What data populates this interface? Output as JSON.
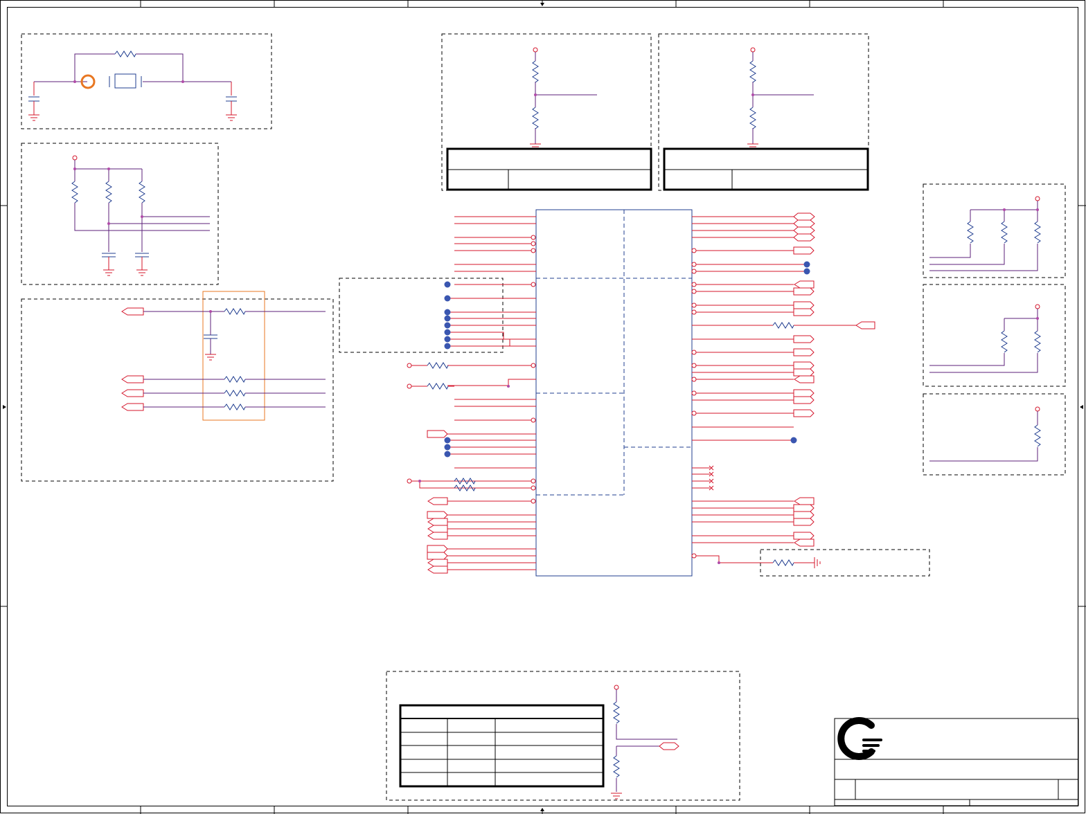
{
  "sheet": {
    "type": "schematic",
    "border_color": "#000000",
    "wire_color": "#d4142a",
    "net_color": "#5b1f7a",
    "component_color": "#1f3c8f",
    "highlight_color": "#e87722",
    "junction_color": "#3a56b0"
  },
  "title_block": {
    "logo": "company-logo",
    "logo_color": "#000000"
  },
  "blocks": {
    "crystal_circuit": {
      "highlighted_component": "orange-ring"
    },
    "strap_left": {},
    "strap_right": {},
    "pullup_group_top": {},
    "pullup_group_mid": {},
    "pullup_group_bottom": {},
    "series_resistor_group": {
      "highlight": "orange-box"
    },
    "main_ic": {},
    "bottom_divider": {}
  }
}
